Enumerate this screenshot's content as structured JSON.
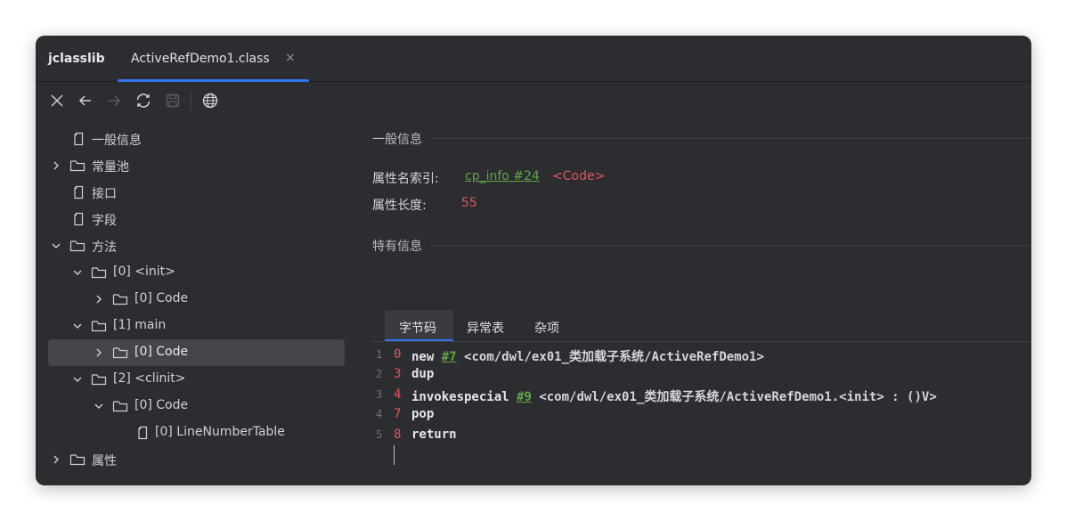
{
  "app": {
    "title": "jclasslib"
  },
  "tab": {
    "label": "ActiveRefDemo1.class",
    "close": "×"
  },
  "tree": [
    {
      "label": "一般信息"
    },
    {
      "label": "常量池"
    },
    {
      "label": "接口"
    },
    {
      "label": "字段"
    },
    {
      "label": "方法"
    },
    {
      "label": "[0] <init>"
    },
    {
      "label": "[0] Code"
    },
    {
      "label": "[1] main"
    },
    {
      "label": "[0] Code"
    },
    {
      "label": "[2] <clinit>"
    },
    {
      "label": "[0] Code"
    },
    {
      "label": "[0] LineNumberTable"
    },
    {
      "label": "属性"
    }
  ],
  "general": {
    "title": "一般信息",
    "name_index_label": "属性名索引:",
    "name_index_link": "cp_info #24",
    "name_index_value": "<Code>",
    "length_label": "属性长度:",
    "length_value": "55"
  },
  "specific": {
    "title": "特有信息"
  },
  "subtabs": [
    {
      "label": "字节码"
    },
    {
      "label": "异常表"
    },
    {
      "label": "杂项"
    }
  ],
  "bytecode": [
    {
      "line": "1",
      "offset": "0",
      "op": "new",
      "ref": "#7",
      "arg": "<com/dwl/ex01_类加载子系统/ActiveRefDemo1>"
    },
    {
      "line": "2",
      "offset": "3",
      "op": "dup"
    },
    {
      "line": "3",
      "offset": "4",
      "op": "invokespecial",
      "ref": "#9",
      "arg": "<com/dwl/ex01_类加载子系统/ActiveRefDemo1.<init> : ()V>"
    },
    {
      "line": "4",
      "offset": "7",
      "op": "pop"
    },
    {
      "line": "5",
      "offset": "8",
      "op": "return"
    }
  ],
  "colors": {
    "accent": "#3574f0",
    "link": "#5fa547",
    "value": "#e0555b",
    "background": "#2b2d30"
  },
  "icons": {
    "toolbar": [
      "close-icon",
      "back-icon",
      "forward-icon",
      "refresh-icon",
      "save-icon",
      "globe-icon"
    ],
    "tree": [
      "folder-icon",
      "file-icon",
      "chevron-right-icon",
      "chevron-down-icon"
    ]
  }
}
